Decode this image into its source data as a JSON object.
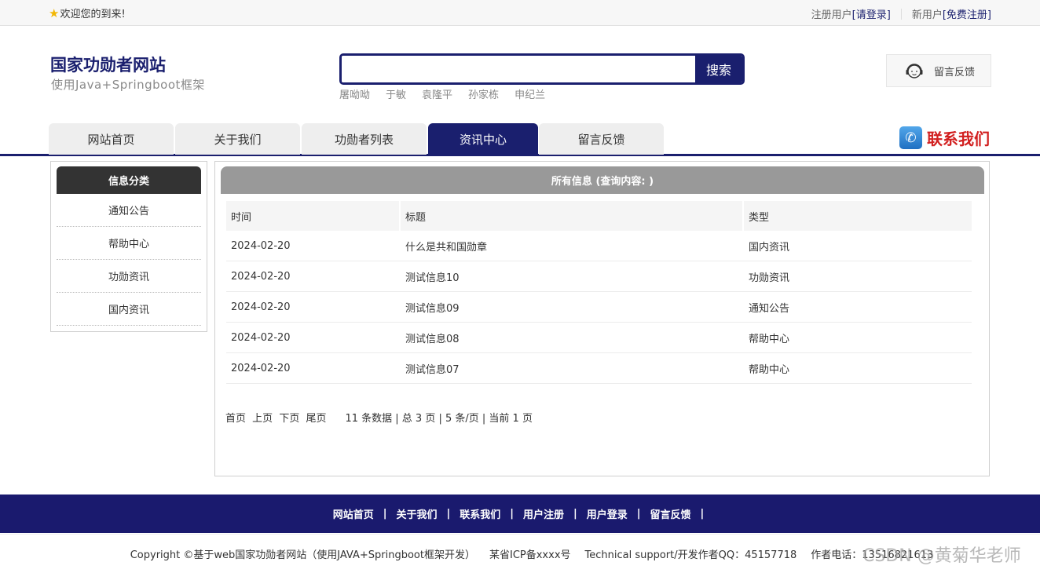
{
  "topbar": {
    "welcome": "欢迎您的到来!",
    "reg_user_label": "注册用户",
    "login_link": "[请登录]",
    "new_user_label": "新用户",
    "signup_link": "[免费注册]"
  },
  "header": {
    "site_title": "国家功勋者网站",
    "site_subtitle": "使用Java+Springboot框架",
    "search": {
      "value": "",
      "placeholder": "",
      "button": "搜索"
    },
    "hot_words": [
      "屠呦呦",
      "于敏",
      "袁隆平",
      "孙家栋",
      "申纪兰"
    ],
    "feedback_button": "留言反馈"
  },
  "nav": {
    "tabs": [
      "网站首页",
      "关于我们",
      "功勋者列表",
      "资讯中心",
      "留言反馈"
    ],
    "active_tab": "资讯中心",
    "contact": "联系我们"
  },
  "sidebar": {
    "title": "信息分类",
    "items": [
      "通知公告",
      "帮助中心",
      "功勋资讯",
      "国内资讯"
    ]
  },
  "main": {
    "title": "所有信息 (查询内容: )",
    "columns": [
      "时间",
      "标题",
      "类型"
    ],
    "rows": [
      [
        "2024-02-20",
        "什么是共和国勋章",
        "国内资讯"
      ],
      [
        "2024-02-20",
        "测试信息10",
        "功勋资讯"
      ],
      [
        "2024-02-20",
        "测试信息09",
        "通知公告"
      ],
      [
        "2024-02-20",
        "测试信息08",
        "帮助中心"
      ],
      [
        "2024-02-20",
        "测试信息07",
        "帮助中心"
      ]
    ],
    "pager": {
      "first": "首页",
      "prev": "上页",
      "next": "下页",
      "last": "尾页",
      "info": "11 条数据 | 总 3 页 | 5 条/页 | 当前 1 页"
    }
  },
  "footer": {
    "links": [
      "网站首页",
      "关于我们",
      "联系我们",
      "用户注册",
      "用户登录",
      "留言反馈"
    ],
    "copyright": "Copyright ©基于web国家功勋者网站（使用JAVA+Springboot框架开发）",
    "icp": "某省ICP备xxxx号",
    "support": "Technical support/开发作者QQ：45157718",
    "phone": "作者电话：13516821613",
    "watermark": "CSDN @黄菊华老师"
  },
  "colors": {
    "brand": "#1a1f6e",
    "contact_red": "#d22020",
    "panel_header": "#999999",
    "sidebar_header": "#333333"
  }
}
